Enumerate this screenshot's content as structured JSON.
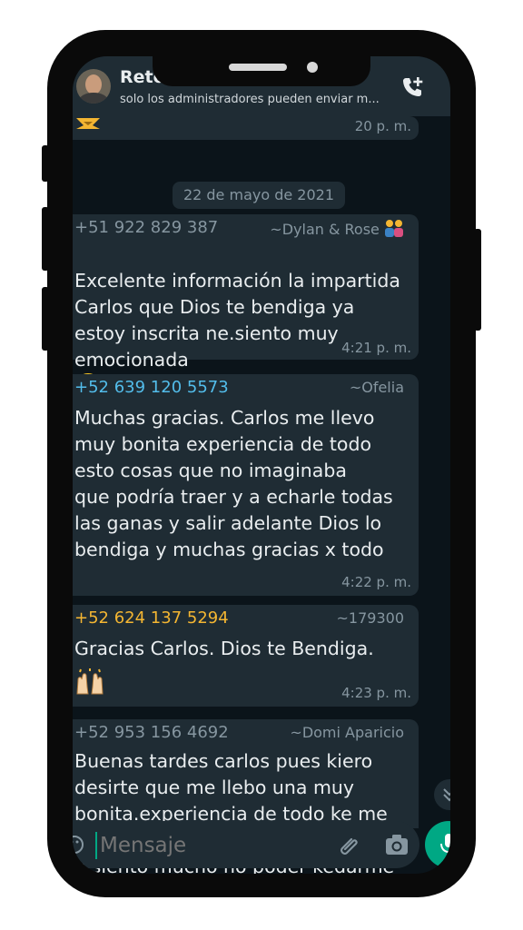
{
  "header": {
    "title": "Reto",
    "subtitle": "solo los administradores pueden enviar m..."
  },
  "chat": {
    "partial_time": "20 p. m.",
    "date_chip": "22 de mayo de 2021",
    "messages": [
      {
        "sender": "+51 922 829 387",
        "sender_color": "#8696a0",
        "alias": "~Dylan & Rose",
        "alias_emoji": "couple-emoji",
        "text": "Excelente información la impartida\nCarlos que Dios te  bendiga ya\nestoy inscrita ne.siento muy\nemocionada",
        "emoji": "grinning-face-emoji",
        "time": "4:21 p. m."
      },
      {
        "sender": "+52 639 120 5573",
        "sender_color": "#53bdeb",
        "alias": "~Ofelia",
        "text": "Muchas gracias. Carlos me llevo\nmuy bonita experiencia de todo\nesto cosas que no imaginaba\nque podría traer y a echarle todas\nlas ganas y salir adelante Dios lo\nbendiga y muchas gracias x todo",
        "time": "4:22 p. m."
      },
      {
        "sender": "+52 624 137 5294",
        "sender_color": "#f4b632",
        "alias": "~179300",
        "text": "Gracias  Carlos. Dios te Bendiga.",
        "emoji": "raised-hands-emoji",
        "time": "4:23 p. m."
      },
      {
        "sender": "+52 953 156 4692",
        "sender_color": "#8696a0",
        "alias": "~Domi Aparicio",
        "text": "Buenas tardes carlos pues kiero\ndesirte que me llebo una muy\nbonita.experiencia de todo ke me\nmostraste con tus conosimientos\ny siento mucho no poder kedarme"
      }
    ]
  },
  "input": {
    "placeholder": "Mensaje"
  },
  "colors": {
    "background": "#0b141a",
    "bubble": "#1f2c34",
    "accent": "#00a884",
    "text": "#e9edef",
    "meta": "#8696a0"
  }
}
